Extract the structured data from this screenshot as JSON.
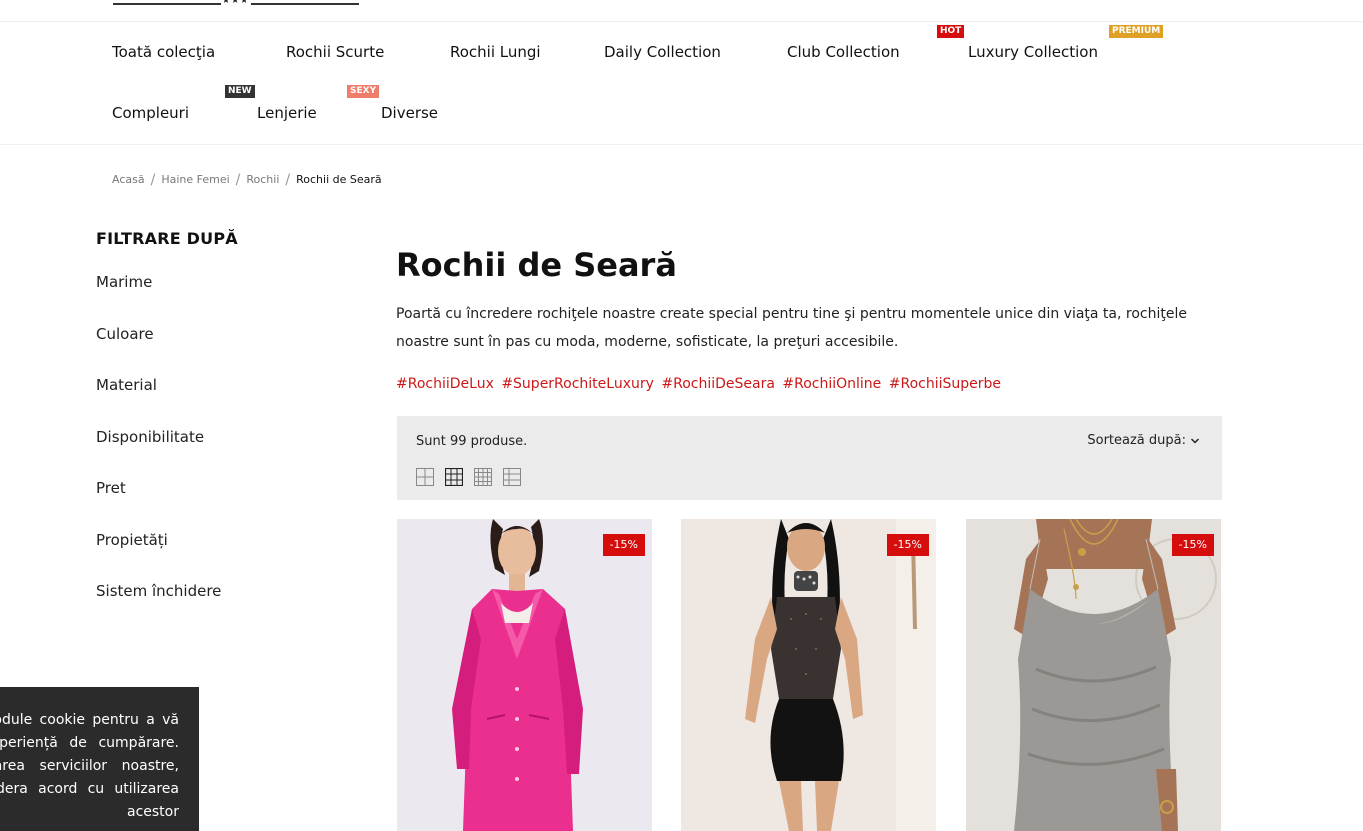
{
  "nav": {
    "items": [
      {
        "label": "Toată colecţia"
      },
      {
        "label": "Rochii Scurte"
      },
      {
        "label": "Rochii Lungi"
      },
      {
        "label": "Daily Collection"
      },
      {
        "label": "Club Collection"
      },
      {
        "label": "Luxury Collection"
      },
      {
        "label": "Compleuri"
      },
      {
        "label": "Lenjerie"
      },
      {
        "label": "Diverse"
      }
    ],
    "badges": [
      {
        "label": "HOT",
        "color": "#d50d0d"
      },
      {
        "label": "PREMIUM",
        "color": "#e0a024"
      },
      {
        "label": "NEW",
        "color": "#333333"
      },
      {
        "label": "SEXY",
        "color": "#f07c6c"
      }
    ]
  },
  "breadcrumb": [
    "Acasă",
    "Haine Femei",
    "Rochii",
    "Rochii de Seară"
  ],
  "sidebar": {
    "title": "FILTRARE DUPĂ",
    "filters": [
      "Marime",
      "Culoare",
      "Material",
      "Disponibilitate",
      "Pret",
      "Propietăți",
      "Sistem închidere"
    ]
  },
  "main": {
    "title": "Rochii de Seară",
    "description": "Poartă cu încredere rochiţele noastre create special pentru tine şi pentru momentele unice din viaţa ta, rochiţele noastre sunt în pas cu moda, moderne, sofisticate, la preţuri accesibile.",
    "hashtags": [
      "#RochiiDeLux",
      "#SuperRochiteLuxury",
      "#RochiiDeSeara",
      "#RochiiOnline",
      "#RochiiSuperbe"
    ],
    "accent_color": "#cc1818"
  },
  "toolbar": {
    "count_text": "Sunt 99 produse.",
    "sort_label": "Sortează după:",
    "view_icons": [
      "grid-2-icon",
      "grid-3-icon",
      "grid-4-icon",
      "list-icon"
    ]
  },
  "products": [
    {
      "discount": "-15%",
      "image": "pink satin blazer dress"
    },
    {
      "discount": "-15%",
      "image": "black sequin bodycon dress"
    },
    {
      "discount": "-15%",
      "image": "silver cowl-neck slip dress"
    }
  ],
  "cookie": {
    "text": "Folosim module cookie pentru a vă oferi o experiență de cumpărare. Prin utilizarea serviciilor noastre, vom considera acord cu utilizarea acestor"
  }
}
